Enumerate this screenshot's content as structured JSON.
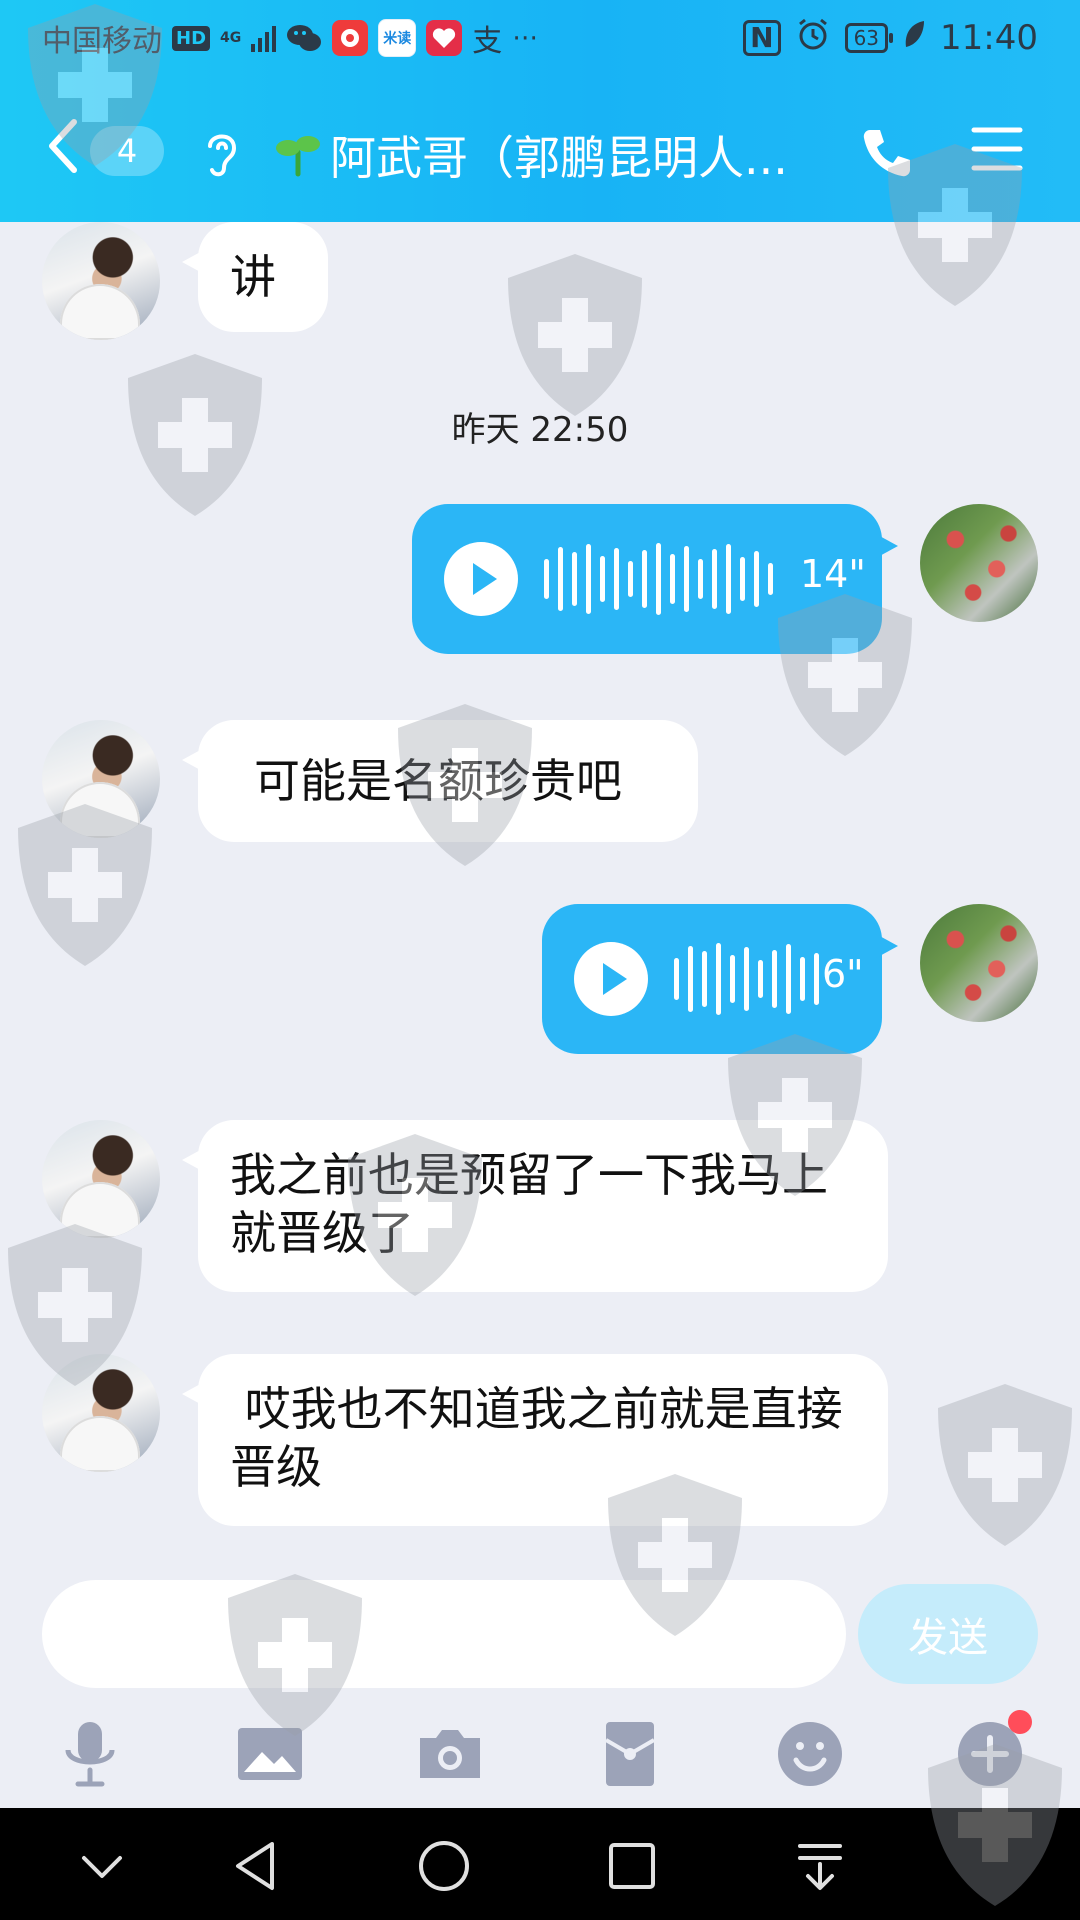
{
  "status_bar": {
    "carrier": "中国移动",
    "hd": "HD",
    "network": "4G",
    "battery": "63",
    "time": "11:40",
    "app_icons": [
      "wechat",
      "app-red",
      "米读",
      "app-heart",
      "支"
    ]
  },
  "header": {
    "unread_count": "4",
    "title": "阿武哥（郭鹏昆明人...",
    "accent": "#1ec8f5"
  },
  "messages": [
    {
      "from": "friend",
      "type": "text",
      "text": "讲"
    },
    {
      "type": "timestamp",
      "text": "昨天 22:50"
    },
    {
      "from": "me",
      "type": "voice",
      "duration": "14\""
    },
    {
      "from": "friend",
      "type": "text",
      "text": "可能是名额珍贵吧"
    },
    {
      "from": "me",
      "type": "voice",
      "duration": "6\""
    },
    {
      "from": "friend",
      "type": "text",
      "text": "我之前也是预留了一下我马上就晋级了"
    },
    {
      "from": "friend",
      "type": "text",
      "text": " 哎我也不知道我之前就是直接晋级"
    }
  ],
  "composer": {
    "input_value": "",
    "send_label": "发送"
  },
  "toolbar_icons": [
    "microphone-icon",
    "image-icon",
    "camera-icon",
    "red-packet-icon",
    "emoji-icon",
    "plus-icon"
  ]
}
